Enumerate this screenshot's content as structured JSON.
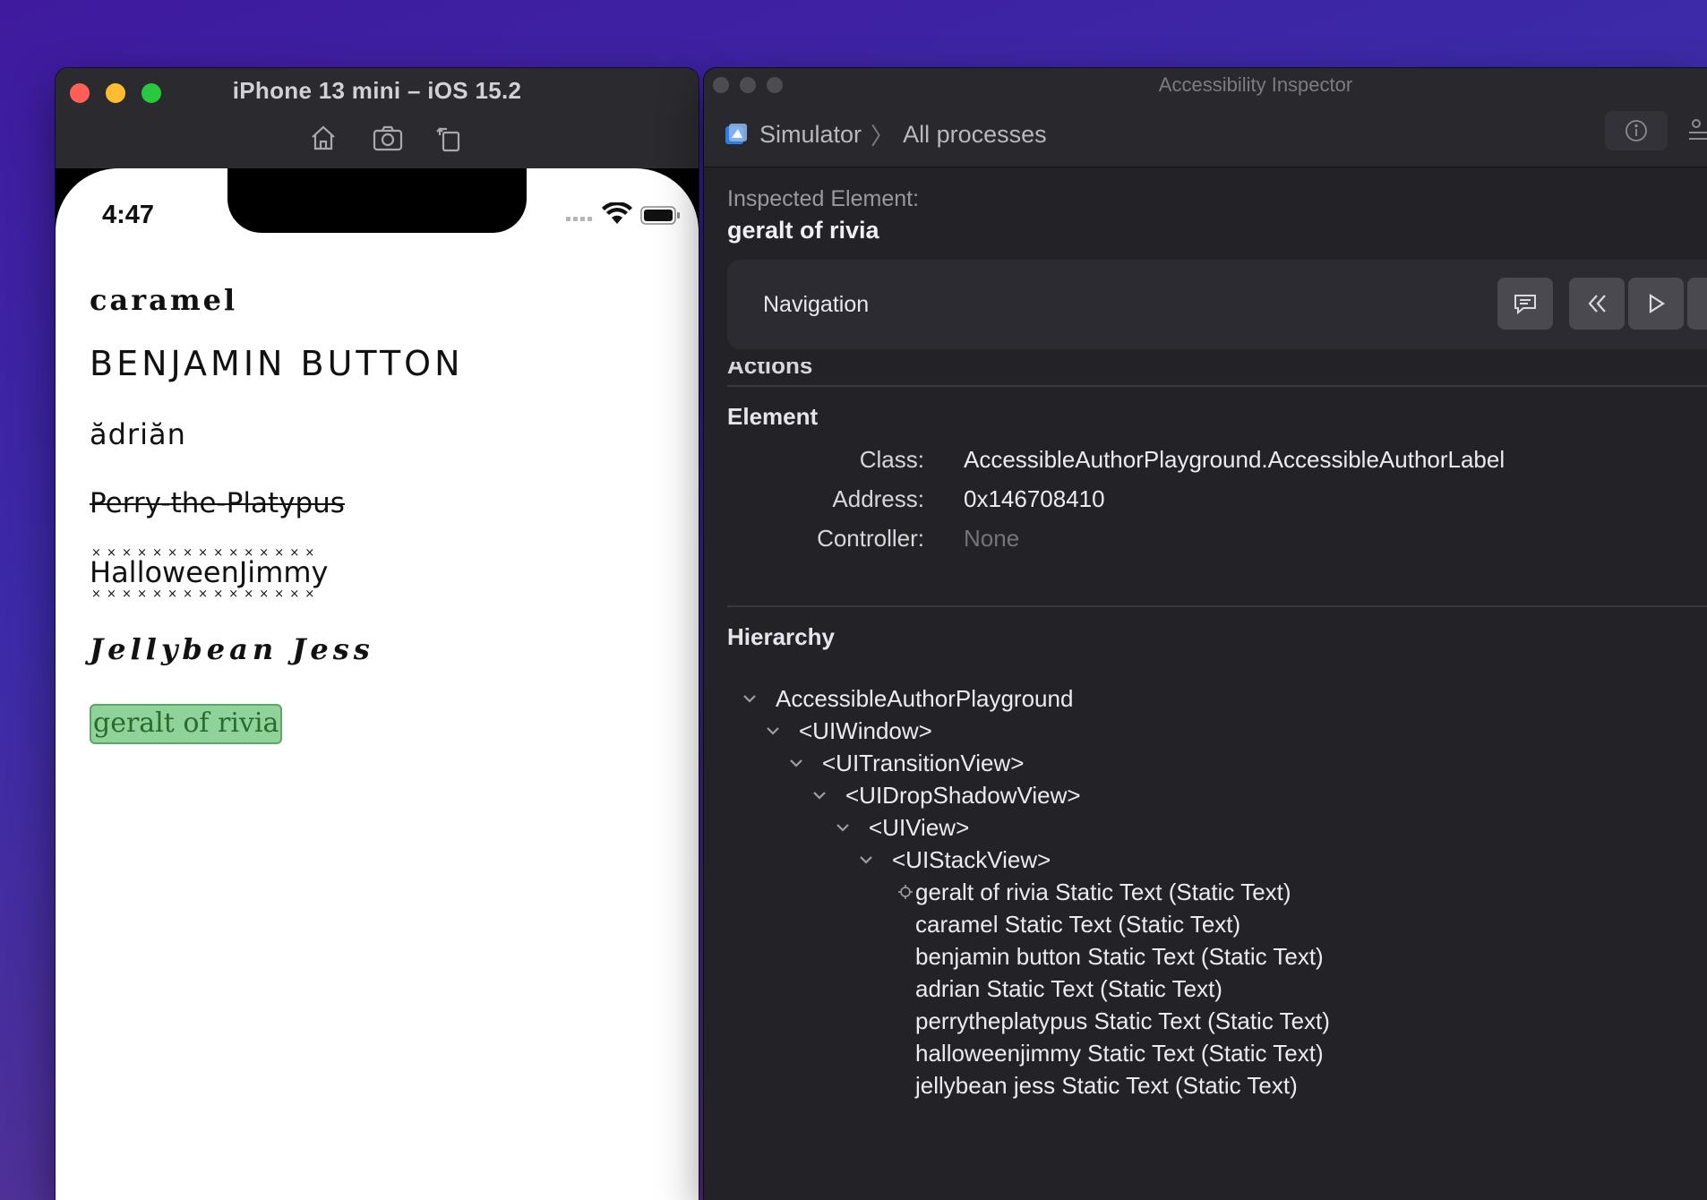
{
  "simulator": {
    "title": "iPhone 13 mini – iOS 15.2",
    "toolbar": {
      "home": "home-icon",
      "screenshot": "camera-icon",
      "rotate": "rotate-icon"
    },
    "status_time": "4:47",
    "labels": {
      "caramel": "caramel",
      "benjamin": "BENJAMIN BUTTON",
      "adrian": "ădriăn",
      "perry": "Perry-the-Platypus",
      "halloween": "HalloweenJimmy",
      "jellybean": "Jellybean Jess",
      "geralt": "geralt of rivia"
    }
  },
  "inspector": {
    "window_title": "Accessibility Inspector",
    "breadcrumb": {
      "target": "Simulator",
      "scope": "All processes"
    },
    "inspected_label": "Inspected Element:",
    "inspected_value": "geralt of rivia",
    "navigation_label": "Navigation",
    "actions_label": "Actions",
    "element": {
      "title": "Element",
      "class_key": "Class:",
      "class_value": "AccessibleAuthorPlayground.AccessibleAuthorLabel",
      "address_key": "Address:",
      "address_value": "0x146708410",
      "controller_key": "Controller:",
      "controller_value": "None"
    },
    "hierarchy": {
      "title": "Hierarchy",
      "nodes": [
        "AccessibleAuthorPlayground",
        "<UIWindow>",
        "<UITransitionView>",
        "<UIDropShadowView>",
        "<UIView>",
        "<UIStackView>"
      ],
      "leaves": [
        "geralt of rivia Static Text (Static Text)",
        "caramel Static Text (Static Text)",
        "benjamin button Static Text (Static Text)",
        "adrian Static Text (Static Text)",
        "perrytheplatypus Static Text (Static Text)",
        "halloweenjimmy Static Text (Static Text)",
        "jellybean jess Static Text (Static Text)"
      ]
    }
  },
  "colors": {
    "close": "#ff5f57",
    "minimize": "#febc2e",
    "zoom": "#28c840",
    "highlight": "#8fd39a"
  }
}
